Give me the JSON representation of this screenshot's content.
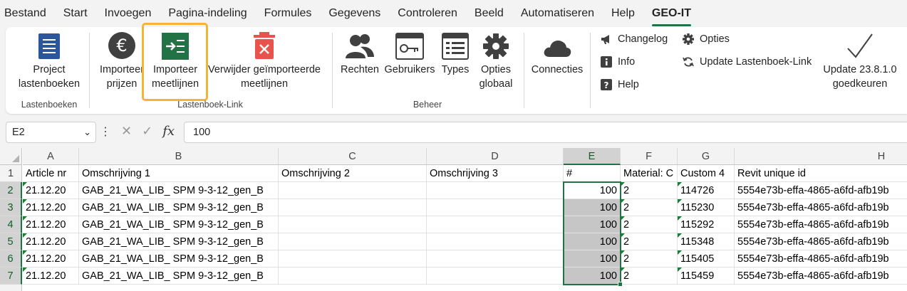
{
  "menu": {
    "tabs": [
      "Bestand",
      "Start",
      "Invoegen",
      "Pagina-indeling",
      "Formules",
      "Gegevens",
      "Controleren",
      "Beeld",
      "Automatiseren",
      "Help",
      "GEO-IT"
    ],
    "active": "GEO-IT"
  },
  "ribbon": {
    "groups": {
      "lastenboeken": "Lastenboeken",
      "lastenboek_link": "Lastenboek-Link",
      "beheer": "Beheer"
    },
    "project_lastenboeken": [
      "Project",
      "lastenboeken"
    ],
    "importeer_prijzen": [
      "Importeer",
      "prijzen"
    ],
    "importeer_meetlijnen": [
      "Importeer",
      "meetlijnen"
    ],
    "verwijder": [
      "Verwijder geïmporteerde",
      "meetlijnen"
    ],
    "rechten": "Rechten",
    "gebruikers": "Gebruikers",
    "types": "Types",
    "opties_globaal": [
      "Opties",
      "globaal"
    ],
    "connecties": "Connecties",
    "changelog": "Changelog",
    "info": "Info",
    "help": "Help",
    "opties": "Opties",
    "update_link": "Update Lastenboek-Link",
    "update_version": [
      "Update 23.8.1.0",
      "goedkeuren"
    ],
    "colors": {
      "green": "#217346",
      "red": "#e8534b",
      "blue": "#2b579a",
      "dark": "#404040",
      "highlight": "#f4b436"
    }
  },
  "formula_bar": {
    "name_box": "E2",
    "fx": "fx",
    "value": "100"
  },
  "sheet": {
    "columns": [
      "A",
      "B",
      "C",
      "D",
      "E",
      "F",
      "G",
      "H"
    ],
    "selected_column": "E",
    "row_numbers": [
      "1",
      "2",
      "3",
      "4",
      "5",
      "6",
      "7"
    ],
    "headers": [
      "Article nr",
      "Omschrijving 1",
      "Omschrijving 2",
      "Omschrijving 3",
      "#",
      "Material: C",
      "Custom 4",
      "Revit unique id"
    ],
    "rows": [
      [
        "21.12.20",
        "GAB_21_WA_LIB_ SPM 9-3-12_gen_B",
        "",
        "",
        "100",
        "2",
        "114726",
        "5554e73b-effa-4865-a6fd-afb19b"
      ],
      [
        "21.12.20",
        "GAB_21_WA_LIB_ SPM 9-3-12_gen_B",
        "",
        "",
        "100",
        "2",
        "115230",
        "5554e73b-effa-4865-a6fd-afb19b"
      ],
      [
        "21.12.20",
        "GAB_21_WA_LIB_ SPM 9-3-12_gen_B",
        "",
        "",
        "100",
        "2",
        "115292",
        "5554e73b-effa-4865-a6fd-afb19b"
      ],
      [
        "21.12.20",
        "GAB_21_WA_LIB_ SPM 9-3-12_gen_B",
        "",
        "",
        "100",
        "2",
        "115348",
        "5554e73b-effa-4865-a6fd-afb19b"
      ],
      [
        "21.12.20",
        "GAB_21_WA_LIB_ SPM 9-3-12_gen_B",
        "",
        "",
        "100",
        "2",
        "115405",
        "5554e73b-effa-4865-a6fd-afb19b"
      ],
      [
        "21.12.20",
        "GAB_21_WA_LIB_ SPM 9-3-12_gen_B",
        "",
        "",
        "100",
        "2",
        "115459",
        "5554e73b-effa-4865-a6fd-afb19b"
      ]
    ]
  }
}
